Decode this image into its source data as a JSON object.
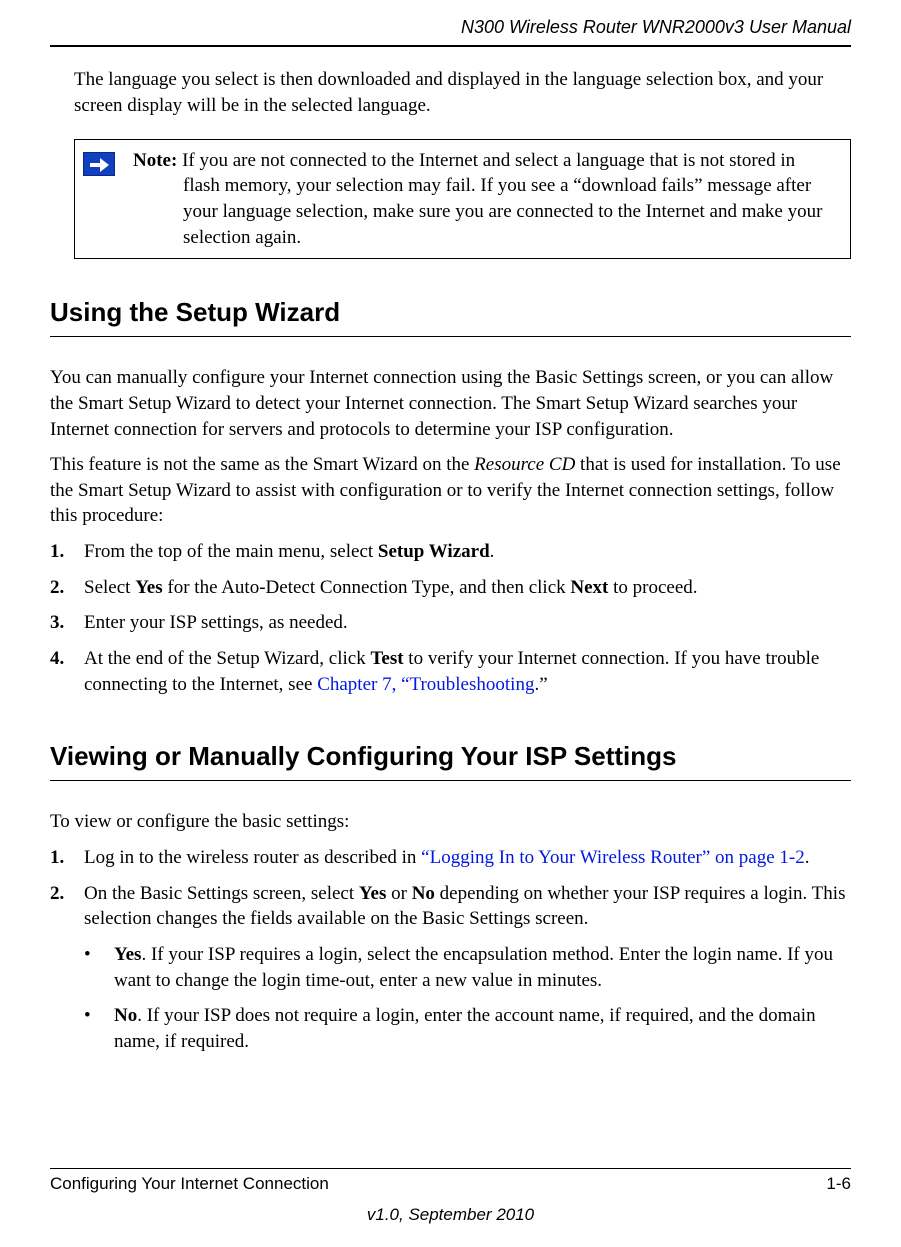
{
  "header": {
    "title": "N300 Wireless Router WNR2000v3 User Manual"
  },
  "intro": "The language you select is then downloaded and displayed in the language selection box, and your screen display will be in the selected language.",
  "note": {
    "label": "Note:",
    "body": " If you are not connected to the Internet and select a language that is not stored in flash memory, your selection may fail. If you see a “download fails” message after your language selection, make sure you are connected to the Internet and make your selection again."
  },
  "section1": {
    "title": "Using the Setup Wizard",
    "para1": "You can manually configure your Internet connection using the Basic Settings screen, or you can allow the Smart Setup Wizard to detect your Internet connection. The Smart Setup Wizard searches your Internet connection for servers and protocols to determine your ISP configuration.",
    "para2_pre": "This feature is not the same as the Smart Wizard on the ",
    "para2_italic": "Resource CD",
    "para2_post": " that is used for installation. To use the Smart Setup Wizard to assist with configuration or to verify the Internet connection settings, follow this procedure:",
    "steps": {
      "s1_num": "1.",
      "s1_pre": "From the top of the main menu, select ",
      "s1_bold": "Setup Wizard",
      "s1_post": ".",
      "s2_num": "2.",
      "s2_pre": "Select ",
      "s2_b1": "Yes",
      "s2_mid": " for the Auto-Detect Connection Type, and then click ",
      "s2_b2": "Next",
      "s2_post": " to proceed.",
      "s3_num": "3.",
      "s3_text": "Enter your ISP settings, as needed.",
      "s4_num": "4.",
      "s4_pre": "At the end of the Setup Wizard, click ",
      "s4_bold": "Test",
      "s4_mid": " to verify your Internet connection. If you have trouble connecting to the Internet, see ",
      "s4_link": "Chapter 7, “Troubleshooting",
      "s4_post": ".”"
    }
  },
  "section2": {
    "title": "Viewing or Manually Configuring Your ISP Settings",
    "intro": "To view or configure the basic settings:",
    "steps": {
      "s1_num": "1.",
      "s1_pre": "Log in to the wireless router as described in ",
      "s1_link": "“Logging In to Your Wireless Router” on page 1-2",
      "s1_post": ".",
      "s2_num": "2.",
      "s2_pre": "On the Basic Settings screen, select ",
      "s2_b1": "Yes",
      "s2_mid1": " or ",
      "s2_b2": "No",
      "s2_post": " depending on whether your ISP requires a login. This selection changes the fields available on the Basic Settings screen."
    },
    "bullets": {
      "b1_bold": "Yes",
      "b1_text": ". If your ISP requires a login, select the encapsulation method. Enter the login name. If you want to change the login time-out, enter a new value in minutes.",
      "b2_bold": "No",
      "b2_text": ". If your ISP does not require a login, enter the account name, if required, and the domain name, if required."
    }
  },
  "footer": {
    "left": "Configuring Your Internet Connection",
    "right": "1-6",
    "version": "v1.0, September 2010"
  }
}
